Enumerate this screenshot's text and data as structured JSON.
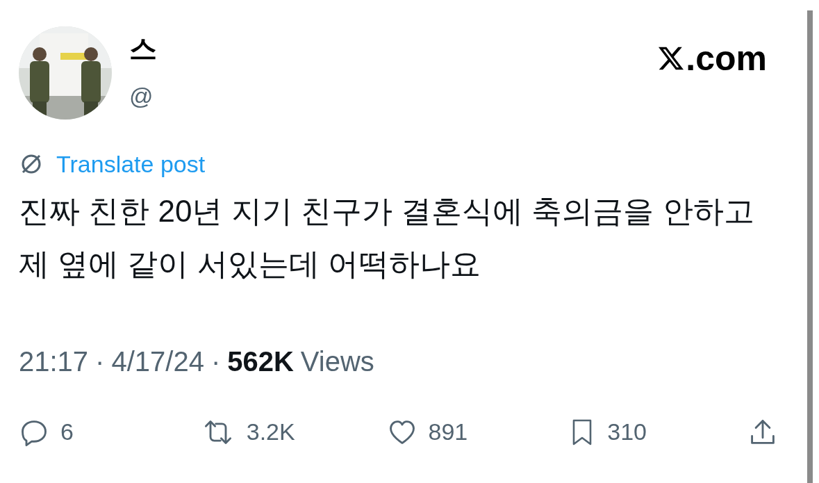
{
  "author": {
    "name": "스",
    "handle": "@"
  },
  "site": {
    "label": ".com"
  },
  "translate": {
    "label": "Translate post"
  },
  "body": "진짜 친한 20년 지기 친구가 결혼식에 축의금을 안하고 제 옆에 같이 서있는데 어떡하나요",
  "meta": {
    "time": "21:17",
    "sep1": "·",
    "date": "4/17/24",
    "sep2": "·",
    "views_count": "562K",
    "views_label": "Views"
  },
  "actions": [
    {
      "kind": "reply",
      "count": "6"
    },
    {
      "kind": "repost",
      "count": "3.2K"
    },
    {
      "kind": "like",
      "count": "891"
    },
    {
      "kind": "bookmark",
      "count": "310"
    },
    {
      "kind": "share"
    }
  ]
}
